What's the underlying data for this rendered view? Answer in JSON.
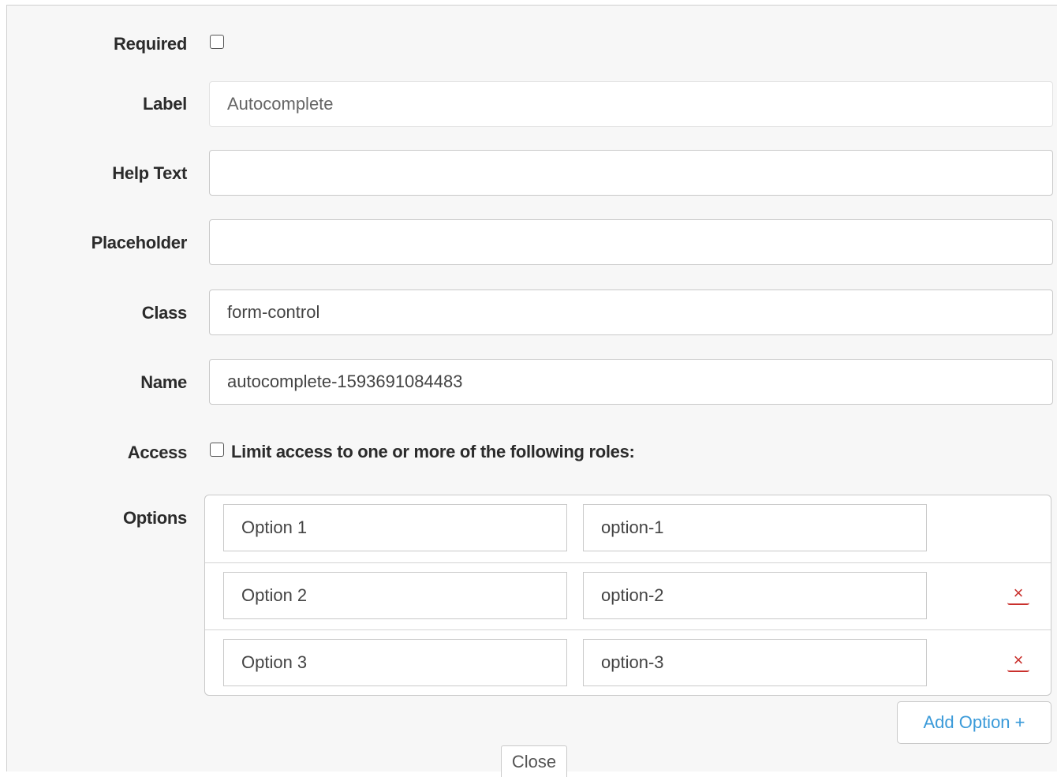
{
  "form": {
    "required": {
      "label": "Required",
      "checked": false
    },
    "label_field": {
      "label": "Label",
      "value": "Autocomplete"
    },
    "help_text": {
      "label": "Help Text",
      "value": ""
    },
    "placeholder": {
      "label": "Placeholder",
      "value": ""
    },
    "class_field": {
      "label": "Class",
      "value": "form-control"
    },
    "name_field": {
      "label": "Name",
      "value": "autocomplete-1593691084483"
    },
    "access": {
      "label": "Access",
      "checkbox_text": "Limit access to one or more of the following roles:",
      "checked": false
    },
    "options": {
      "label": "Options",
      "rows": [
        {
          "label": "Option 1",
          "value": "option-1",
          "removable": false
        },
        {
          "label": "Option 2",
          "value": "option-2",
          "removable": true
        },
        {
          "label": "Option 3",
          "value": "option-3",
          "removable": true
        }
      ],
      "remove_glyph": "×",
      "add_button": "Add Option +"
    }
  },
  "footer": {
    "close_button": "Close"
  },
  "colors": {
    "accent": "#3a9ad9",
    "danger": "#c9302c",
    "panel_bg": "#f7f7f7"
  }
}
